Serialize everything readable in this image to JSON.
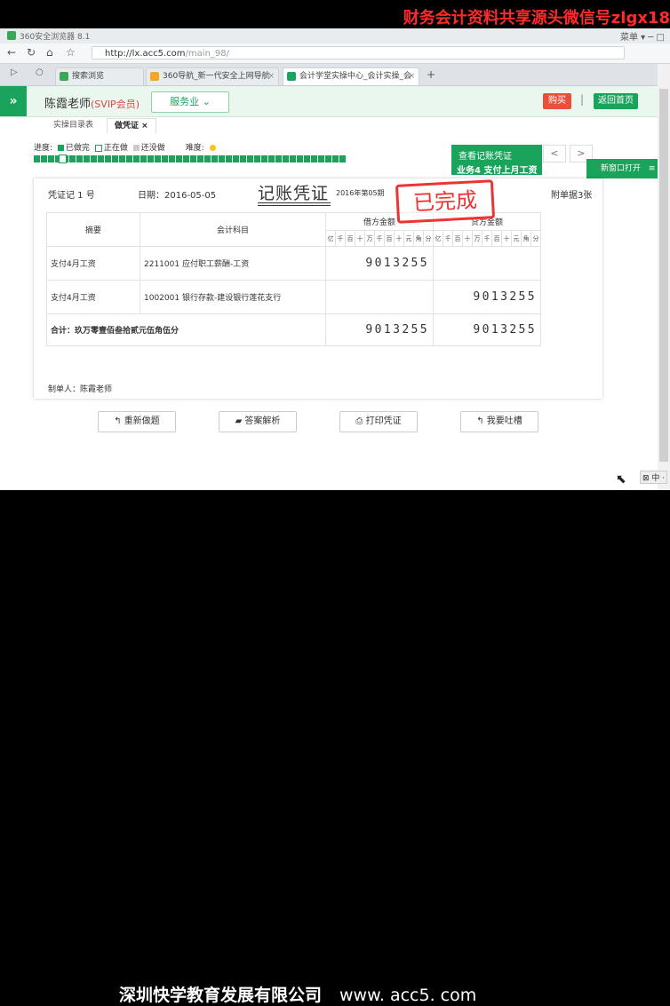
{
  "banner": {
    "text": "财务会计资料共享源头微信号zlgx18"
  },
  "browser": {
    "title": "360安全浏览器 8.1",
    "window_controls": "菜单 ▾ ─ □",
    "url_host": "http://lx.acc5.com",
    "url_path": "/main_98/",
    "tabs": [
      {
        "label": "搜索浏览",
        "color": "#3aa757"
      },
      {
        "label": "360导航_新一代安全上网导航",
        "color": "#f5a623"
      },
      {
        "label": "会计学堂实操中心_会计实操_会",
        "color": "#19a35b"
      }
    ],
    "new_tab": "+"
  },
  "header": {
    "teacher": "陈霞老师",
    "vip": "(SVIP会员)",
    "service": "服务业 ⌄",
    "buy": "购买",
    "separator": "|",
    "home": "返回首页"
  },
  "subtabs": [
    {
      "label": "实操目录表"
    },
    {
      "label": "做凭证 ×"
    }
  ],
  "progress": {
    "label": "进度:",
    "done": "已做完",
    "doing": "正在做",
    "todo": "还没做",
    "difficulty_label": "难度:",
    "done_fraction": 1.0
  },
  "sidepanel": {
    "check_voucher": "查看记账凭证",
    "task": "业务4  支付上月工资",
    "prev": "<",
    "next": ">",
    "new_window": "新窗口打开"
  },
  "voucher": {
    "number": "凭证记 1 号",
    "date": "日期：2016-05-05",
    "title": "记账凭证",
    "period": "2016年第05期",
    "attachments": "附单据3张",
    "stamp": "已完成",
    "col_summary": "摘要",
    "col_account": "会计科目",
    "col_debit": "借方金额",
    "col_credit": "贷方金额",
    "digits": [
      "亿",
      "千",
      "百",
      "十",
      "万",
      "千",
      "百",
      "十",
      "元",
      "角",
      "分"
    ],
    "rows": [
      {
        "summary": "支付4月工资",
        "account": "2211001 应付职工薪酬-工资",
        "debit": "9013255",
        "credit": ""
      },
      {
        "summary": "支付4月工资",
        "account": "1002001 银行存款-建设银行莲花支行",
        "debit": "",
        "credit": "9013255"
      }
    ],
    "total_label": "合计：玖万零壹佰叁拾贰元伍角伍分",
    "total_debit": "9013255",
    "total_credit": "9013255",
    "maker": "制单人：陈霞老师"
  },
  "actions": {
    "redo": "↰ 重新做题",
    "answer": "▰ 答案解析",
    "print": "⎙ 打印凭证",
    "feedback": "↰ 我要吐槽"
  },
  "footer": {
    "company": "深圳快学教育发展有限公司",
    "url": "www. acc5. com"
  },
  "ime": "⊠ 中 ·"
}
